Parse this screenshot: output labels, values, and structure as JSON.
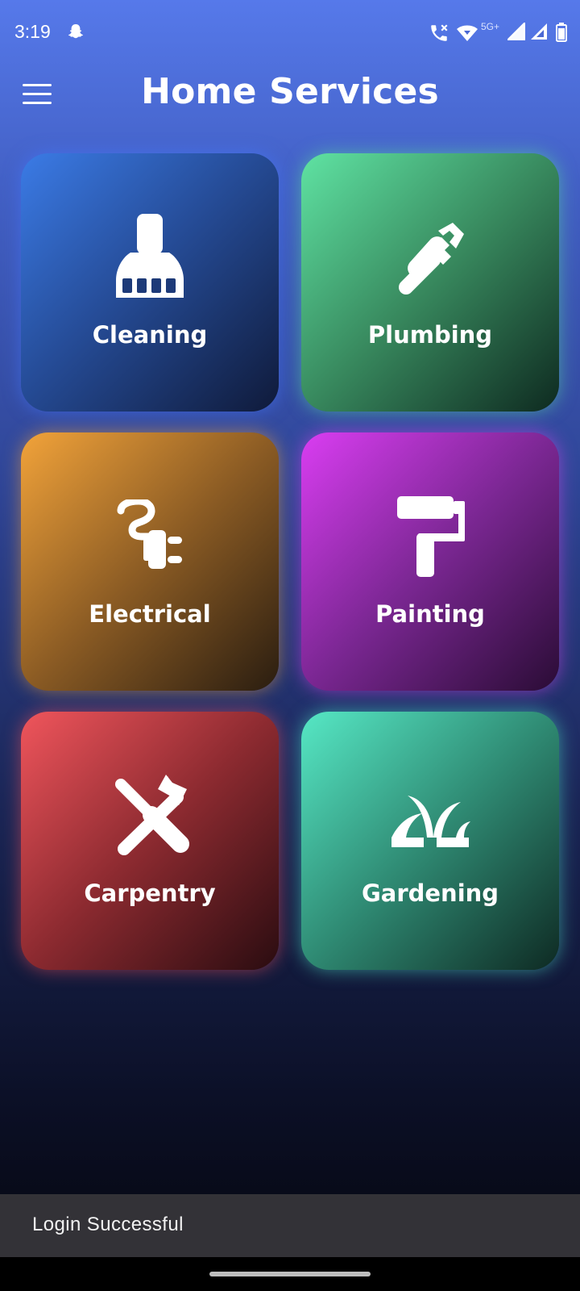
{
  "status_bar": {
    "time": "3:19",
    "network_label": "5G+",
    "icons": [
      "snapchat-icon",
      "call-icon",
      "wifi-icon",
      "signal-icon",
      "signal-icon",
      "battery-icon"
    ]
  },
  "app_bar": {
    "title": "Home Services",
    "menu_icon": "menu-icon"
  },
  "services": [
    {
      "label": "Cleaning",
      "icon": "broom-icon",
      "color": "#3b7be6"
    },
    {
      "label": "Plumbing",
      "icon": "pipe-wrench-icon",
      "color": "#5fe3a3"
    },
    {
      "label": "Electrical",
      "icon": "plug-icon",
      "color": "#f2a33a"
    },
    {
      "label": "Painting",
      "icon": "paint-roller-icon",
      "color": "#da3df2"
    },
    {
      "label": "Carpentry",
      "icon": "tools-icon",
      "color": "#f0555c"
    },
    {
      "label": "Gardening",
      "icon": "grass-icon",
      "color": "#56e8c5"
    }
  ],
  "snackbar": {
    "message": "Login Successful"
  }
}
